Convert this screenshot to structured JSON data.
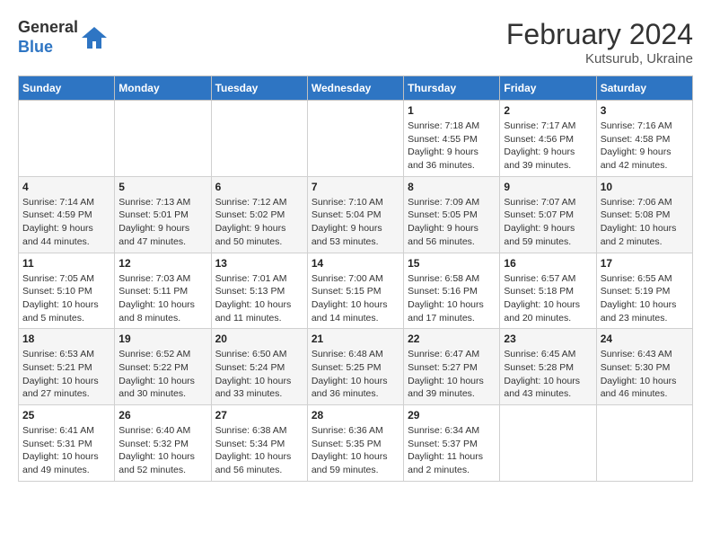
{
  "header": {
    "logo_line1": "General",
    "logo_line2": "Blue",
    "month_year": "February 2024",
    "location": "Kutsurub, Ukraine"
  },
  "weekdays": [
    "Sunday",
    "Monday",
    "Tuesday",
    "Wednesday",
    "Thursday",
    "Friday",
    "Saturday"
  ],
  "weeks": [
    [
      {
        "day": "",
        "info": ""
      },
      {
        "day": "",
        "info": ""
      },
      {
        "day": "",
        "info": ""
      },
      {
        "day": "",
        "info": ""
      },
      {
        "day": "1",
        "info": "Sunrise: 7:18 AM\nSunset: 4:55 PM\nDaylight: 9 hours\nand 36 minutes."
      },
      {
        "day": "2",
        "info": "Sunrise: 7:17 AM\nSunset: 4:56 PM\nDaylight: 9 hours\nand 39 minutes."
      },
      {
        "day": "3",
        "info": "Sunrise: 7:16 AM\nSunset: 4:58 PM\nDaylight: 9 hours\nand 42 minutes."
      }
    ],
    [
      {
        "day": "4",
        "info": "Sunrise: 7:14 AM\nSunset: 4:59 PM\nDaylight: 9 hours\nand 44 minutes."
      },
      {
        "day": "5",
        "info": "Sunrise: 7:13 AM\nSunset: 5:01 PM\nDaylight: 9 hours\nand 47 minutes."
      },
      {
        "day": "6",
        "info": "Sunrise: 7:12 AM\nSunset: 5:02 PM\nDaylight: 9 hours\nand 50 minutes."
      },
      {
        "day": "7",
        "info": "Sunrise: 7:10 AM\nSunset: 5:04 PM\nDaylight: 9 hours\nand 53 minutes."
      },
      {
        "day": "8",
        "info": "Sunrise: 7:09 AM\nSunset: 5:05 PM\nDaylight: 9 hours\nand 56 minutes."
      },
      {
        "day": "9",
        "info": "Sunrise: 7:07 AM\nSunset: 5:07 PM\nDaylight: 9 hours\nand 59 minutes."
      },
      {
        "day": "10",
        "info": "Sunrise: 7:06 AM\nSunset: 5:08 PM\nDaylight: 10 hours\nand 2 minutes."
      }
    ],
    [
      {
        "day": "11",
        "info": "Sunrise: 7:05 AM\nSunset: 5:10 PM\nDaylight: 10 hours\nand 5 minutes."
      },
      {
        "day": "12",
        "info": "Sunrise: 7:03 AM\nSunset: 5:11 PM\nDaylight: 10 hours\nand 8 minutes."
      },
      {
        "day": "13",
        "info": "Sunrise: 7:01 AM\nSunset: 5:13 PM\nDaylight: 10 hours\nand 11 minutes."
      },
      {
        "day": "14",
        "info": "Sunrise: 7:00 AM\nSunset: 5:15 PM\nDaylight: 10 hours\nand 14 minutes."
      },
      {
        "day": "15",
        "info": "Sunrise: 6:58 AM\nSunset: 5:16 PM\nDaylight: 10 hours\nand 17 minutes."
      },
      {
        "day": "16",
        "info": "Sunrise: 6:57 AM\nSunset: 5:18 PM\nDaylight: 10 hours\nand 20 minutes."
      },
      {
        "day": "17",
        "info": "Sunrise: 6:55 AM\nSunset: 5:19 PM\nDaylight: 10 hours\nand 23 minutes."
      }
    ],
    [
      {
        "day": "18",
        "info": "Sunrise: 6:53 AM\nSunset: 5:21 PM\nDaylight: 10 hours\nand 27 minutes."
      },
      {
        "day": "19",
        "info": "Sunrise: 6:52 AM\nSunset: 5:22 PM\nDaylight: 10 hours\nand 30 minutes."
      },
      {
        "day": "20",
        "info": "Sunrise: 6:50 AM\nSunset: 5:24 PM\nDaylight: 10 hours\nand 33 minutes."
      },
      {
        "day": "21",
        "info": "Sunrise: 6:48 AM\nSunset: 5:25 PM\nDaylight: 10 hours\nand 36 minutes."
      },
      {
        "day": "22",
        "info": "Sunrise: 6:47 AM\nSunset: 5:27 PM\nDaylight: 10 hours\nand 39 minutes."
      },
      {
        "day": "23",
        "info": "Sunrise: 6:45 AM\nSunset: 5:28 PM\nDaylight: 10 hours\nand 43 minutes."
      },
      {
        "day": "24",
        "info": "Sunrise: 6:43 AM\nSunset: 5:30 PM\nDaylight: 10 hours\nand 46 minutes."
      }
    ],
    [
      {
        "day": "25",
        "info": "Sunrise: 6:41 AM\nSunset: 5:31 PM\nDaylight: 10 hours\nand 49 minutes."
      },
      {
        "day": "26",
        "info": "Sunrise: 6:40 AM\nSunset: 5:32 PM\nDaylight: 10 hours\nand 52 minutes."
      },
      {
        "day": "27",
        "info": "Sunrise: 6:38 AM\nSunset: 5:34 PM\nDaylight: 10 hours\nand 56 minutes."
      },
      {
        "day": "28",
        "info": "Sunrise: 6:36 AM\nSunset: 5:35 PM\nDaylight: 10 hours\nand 59 minutes."
      },
      {
        "day": "29",
        "info": "Sunrise: 6:34 AM\nSunset: 5:37 PM\nDaylight: 11 hours\nand 2 minutes."
      },
      {
        "day": "",
        "info": ""
      },
      {
        "day": "",
        "info": ""
      }
    ]
  ]
}
